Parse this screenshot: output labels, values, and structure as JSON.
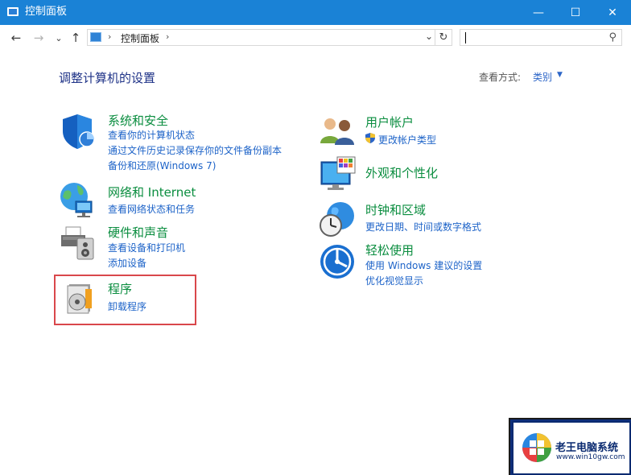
{
  "window": {
    "title": "控制面板",
    "minimize_glyph": "—",
    "maximize_glyph": "☐",
    "close_glyph": "✕"
  },
  "address": {
    "back_glyph": "←",
    "forward_glyph": "→",
    "recent_glyph": "⌄",
    "up_glyph": "↑",
    "separator": "›",
    "crumb": "控制面板",
    "dropdown_glyph": "⌄",
    "refresh_glyph": "↻",
    "search_value": "",
    "search_icon_glyph": "⚲"
  },
  "main": {
    "title": "调整计算机的设置",
    "view_by_label": "查看方式:",
    "view_by_value": "类别",
    "view_by_arrow": "▼"
  },
  "categories": [
    {
      "title": "系统和安全",
      "links": [
        "查看你的计算机状态",
        "通过文件历史记录保存你的文件备份副本",
        "备份和还原(Windows 7)"
      ]
    },
    {
      "title": "网络和 Internet",
      "links": [
        "查看网络状态和任务"
      ]
    },
    {
      "title": "硬件和声音",
      "links": [
        "查看设备和打印机",
        "添加设备"
      ]
    },
    {
      "title": "程序",
      "links": [
        "卸载程序"
      ]
    },
    {
      "title": "用户帐户",
      "links": [
        "更改帐户类型"
      ]
    },
    {
      "title": "外观和个性化",
      "links": []
    },
    {
      "title": "时钟和区域",
      "links": [
        "更改日期、时间或数字格式"
      ]
    },
    {
      "title": "轻松使用",
      "links": [
        "使用 Windows 建议的设置",
        "优化视觉显示"
      ]
    }
  ],
  "watermark": {
    "title": "老王电脑系统",
    "url": "www.win10gw.com"
  },
  "colors": {
    "titlebar": "#1a82d6",
    "category_title": "#0a8d3f",
    "link": "#1d63c8",
    "highlight": "#d9474b"
  }
}
